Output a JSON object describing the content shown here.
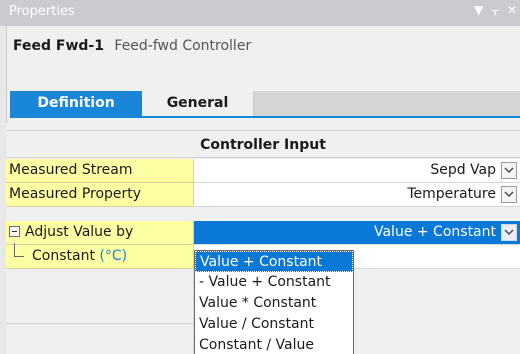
{
  "window": {
    "title": "Properties",
    "pin_glyph": "▾ ᚁ ✕"
  },
  "header": {
    "name": "Feed Fwd-1",
    "type": "Feed-fwd Controller"
  },
  "tabs": [
    {
      "label": "Definition",
      "active": true
    },
    {
      "label": "General",
      "active": false
    }
  ],
  "section": {
    "title": "Controller Input"
  },
  "rows": [
    {
      "label": "Measured Stream",
      "value": "Sepd Vap"
    },
    {
      "label": "Measured Property",
      "value": "Temperature"
    },
    {
      "label": "Adjust Value by",
      "value": "Value + Constant",
      "selected": true,
      "expandable": true
    },
    {
      "label": "Constant",
      "unit": "(°C)",
      "value": ""
    }
  ],
  "dropdown": {
    "options": [
      "Value + Constant",
      "- Value + Constant",
      "Value * Constant",
      "Value / Constant",
      "Constant / Value"
    ],
    "selected_index": 0
  },
  "colors": {
    "accent": "#1a86d8",
    "selection": "#0a78d7",
    "label_bg": "#ffffa3"
  }
}
